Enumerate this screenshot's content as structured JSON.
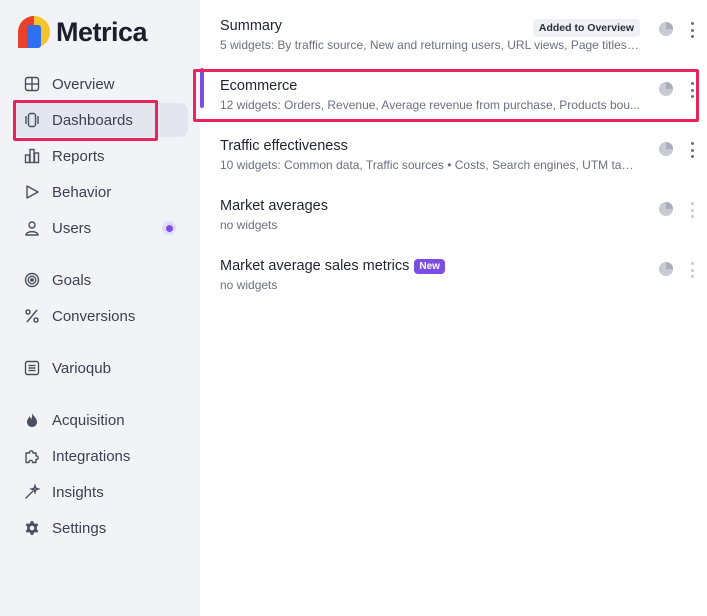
{
  "app": {
    "name": "Metrica"
  },
  "sidebar": {
    "items": [
      {
        "label": "Overview",
        "icon": "grid-icon"
      },
      {
        "label": "Dashboards",
        "icon": "dashboards-icon",
        "active": true
      },
      {
        "label": "Reports",
        "icon": "bar-chart-icon"
      },
      {
        "label": "Behavior",
        "icon": "play-icon"
      },
      {
        "label": "Users",
        "icon": "user-icon",
        "badge": true
      },
      {
        "label": "Goals",
        "icon": "target-icon"
      },
      {
        "label": "Conversions",
        "icon": "percent-icon"
      },
      {
        "label": "Varioqub",
        "icon": "varioqub-icon"
      },
      {
        "label": "Acquisition",
        "icon": "flame-icon"
      },
      {
        "label": "Integrations",
        "icon": "puzzle-icon"
      },
      {
        "label": "Insights",
        "icon": "sparkle-icon"
      },
      {
        "label": "Settings",
        "icon": "gear-icon"
      }
    ]
  },
  "dashboards": [
    {
      "title": "Summary",
      "subtitle": "5 widgets: By traffic source, New and returning users, URL views, Page titles,...",
      "tag": "Added to Overview"
    },
    {
      "title": "Ecommerce",
      "subtitle": "12 widgets: Orders, Revenue, Average revenue from purchase, Products bou..."
    },
    {
      "title": "Traffic effectiveness",
      "subtitle": "10 widgets: Common data, Traffic sources • Costs, Search engines, UTM tags..."
    },
    {
      "title": "Market averages",
      "subtitle": "no widgets"
    },
    {
      "title": "Market average sales metrics",
      "subtitle": "no widgets",
      "tag": "New"
    }
  ],
  "colors": {
    "accent": "#7b4ce6",
    "highlight": "#e8245c",
    "sidebar_bg": "#f2f3f6"
  }
}
